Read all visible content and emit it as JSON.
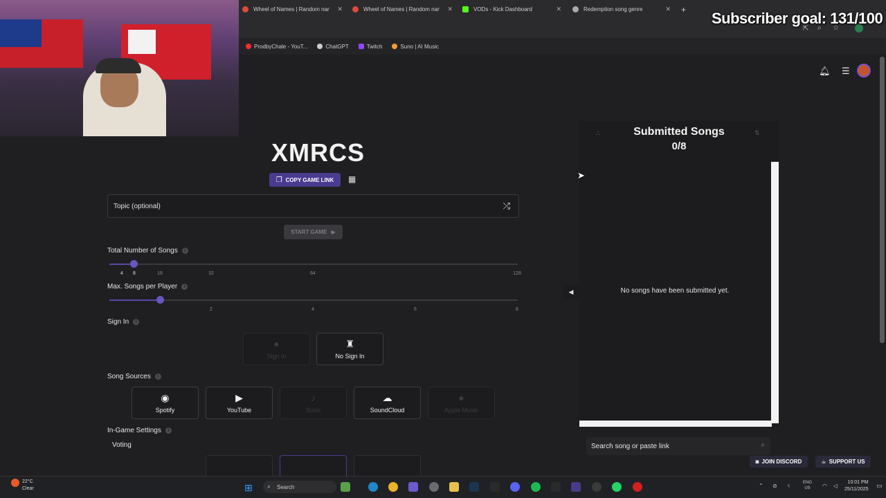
{
  "overlay": {
    "subscriber_goal": "Subscriber goal: 131/100"
  },
  "browser": {
    "tabs": [
      {
        "title": "Wheel of Names | Random nam",
        "color": "#e04a3a"
      },
      {
        "title": "Wheel of Names | Random nam",
        "color": "#e04a3a"
      },
      {
        "title": "VODs - Kick Dashboard",
        "color": "#53fc18"
      },
      {
        "title": "Redemption song genre",
        "color": "#aaaaaa"
      }
    ],
    "new_tab": "+",
    "bookmarks": [
      {
        "label": "ProdbyChale - YouT...",
        "color": "#ff2a2a"
      },
      {
        "label": "ChatGPT",
        "color": "#cccccc"
      },
      {
        "label": "Twitch",
        "color": "#9146ff"
      },
      {
        "label": "Suno | AI Music",
        "color": "#f0a030"
      }
    ]
  },
  "game": {
    "title": "XMRCS",
    "copy_link": "COPY GAME LINK",
    "topic_placeholder": "Topic (optional)",
    "start_game": "START GAME",
    "total_songs": {
      "label": "Total Number of Songs",
      "ticks": [
        "4",
        "8",
        "16",
        "32",
        "64",
        "128"
      ],
      "value": 8
    },
    "max_per_player": {
      "label": "Max. Songs per Player",
      "ticks": [
        "2",
        "4",
        "6",
        "8"
      ],
      "value": 2
    },
    "sign_in": {
      "label": "Sign In",
      "options": [
        {
          "label": "Sign In",
          "enabled": false
        },
        {
          "label": "No Sign In",
          "enabled": true
        }
      ]
    },
    "song_sources": {
      "label": "Song Sources",
      "options": [
        {
          "label": "Spotify",
          "enabled": true,
          "icon": "spotify-icon"
        },
        {
          "label": "YouTube",
          "enabled": true,
          "icon": "youtube-icon"
        },
        {
          "label": "Suno",
          "enabled": false,
          "icon": "suno-icon"
        },
        {
          "label": "SoundCloud",
          "enabled": true,
          "icon": "soundcloud-icon"
        },
        {
          "label": "Apple Music",
          "enabled": false,
          "icon": "apple-icon"
        }
      ]
    },
    "in_game_settings": {
      "label": "In-Game Settings",
      "voting": "Voting"
    }
  },
  "songs_panel": {
    "title": "Submitted Songs",
    "count": "0/8",
    "empty_message": "No songs have been submitted yet.",
    "search_placeholder": "Search song or paste link"
  },
  "footer": {
    "discord": "JOIN DISCORD",
    "support": "SUPPORT US"
  },
  "taskbar": {
    "weather_temp": "22°C",
    "weather_desc": "Clear",
    "search_label": "Search",
    "lang_1": "ENG",
    "lang_2": "US",
    "time": "10:01 PM",
    "date": "25/11/2025"
  }
}
